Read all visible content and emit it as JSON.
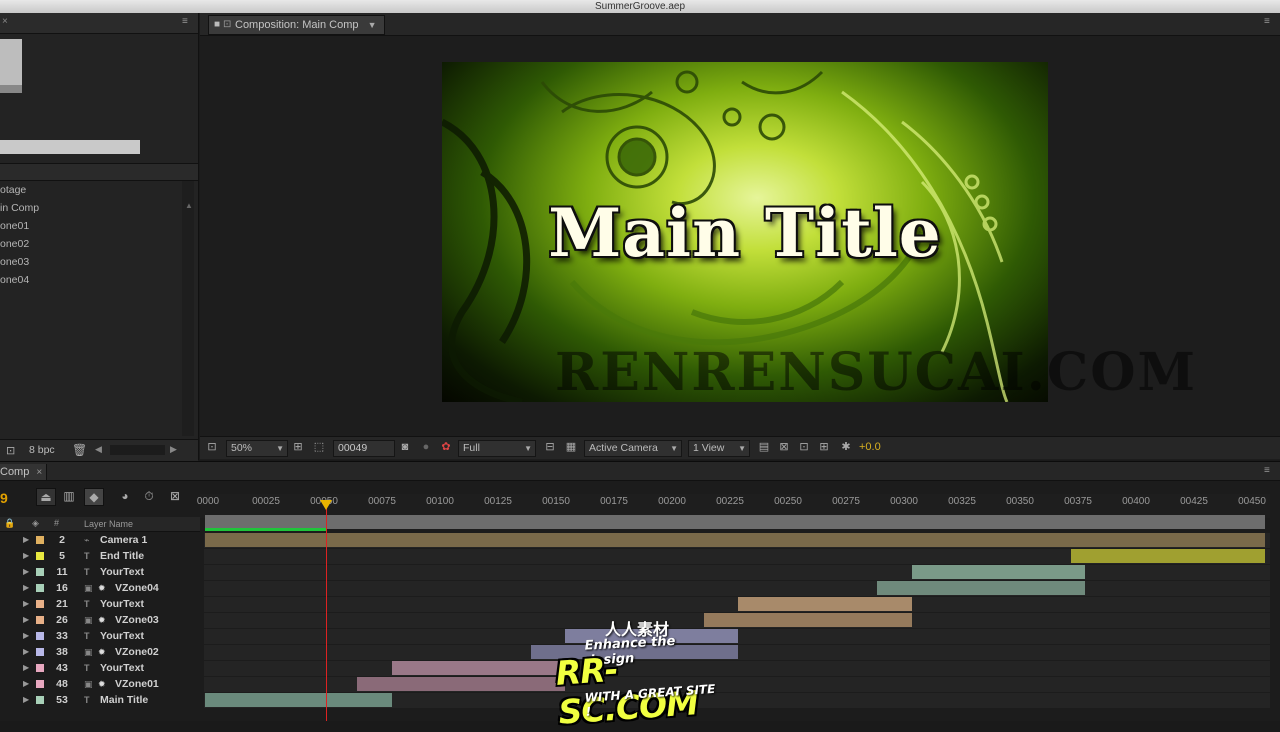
{
  "window": {
    "title": "SummerGroove.aep"
  },
  "project": {
    "items": [
      "otage",
      "in Comp",
      "one01",
      "one02",
      "one03",
      "one04"
    ],
    "footer": {
      "bpc": "8 bpc"
    }
  },
  "composition": {
    "tab_label": "Composition: Main Comp",
    "viewer_title": "Main Title",
    "watermark": "RENRENSUCAI.COM",
    "toolbar": {
      "zoom": "50%",
      "timecode": "00049",
      "resolution": "Full",
      "camera": "Active Camera",
      "views": "1 View",
      "exposure": "+0.0"
    }
  },
  "timeline": {
    "tab_label": "Comp",
    "timecode": "9",
    "column_header": "Layer Name",
    "ruler_ticks": [
      "0000",
      "00025",
      "00050",
      "00075",
      "00100",
      "00125",
      "00150",
      "00175",
      "00200",
      "00225",
      "00250",
      "00275",
      "00300",
      "00325",
      "00350",
      "00375",
      "00400",
      "00425",
      "00450"
    ],
    "layers": [
      {
        "num": "2",
        "name": "Camera 1",
        "type": "camera",
        "color": "#e0b060",
        "bar_start": 0,
        "bar_end": 459,
        "bar_color": "#7a6a4a"
      },
      {
        "num": "5",
        "name": "End Title",
        "type": "text",
        "color": "#e8e840",
        "bar_start": 375,
        "bar_end": 459,
        "bar_color": "#a0a030"
      },
      {
        "num": "11",
        "name": "YourText",
        "type": "text",
        "color": "#a8d0b8",
        "bar_start": 306,
        "bar_end": 381,
        "bar_color": "#7a9a88"
      },
      {
        "num": "16",
        "name": "VZone04",
        "type": "comp",
        "color": "#a8d0b8",
        "bar_start": 291,
        "bar_end": 381,
        "bar_color": "#6f8a7c"
      },
      {
        "num": "21",
        "name": "YourText",
        "type": "text",
        "color": "#e8b088",
        "bar_start": 231,
        "bar_end": 306,
        "bar_color": "#a88a6a"
      },
      {
        "num": "26",
        "name": "VZone03",
        "type": "comp",
        "color": "#e8b088",
        "bar_start": 216,
        "bar_end": 306,
        "bar_color": "#957a5c"
      },
      {
        "num": "33",
        "name": "YourText",
        "type": "text",
        "color": "#b8b8e8",
        "bar_start": 156,
        "bar_end": 231,
        "bar_color": "#7e7e9e"
      },
      {
        "num": "38",
        "name": "VZone02",
        "type": "comp",
        "color": "#b8b8e8",
        "bar_start": 141,
        "bar_end": 231,
        "bar_color": "#6f6f8c"
      },
      {
        "num": "43",
        "name": "YourText",
        "type": "text",
        "color": "#e8a8c0",
        "bar_start": 81,
        "bar_end": 156,
        "bar_color": "#9a7888"
      },
      {
        "num": "48",
        "name": "VZone01",
        "type": "comp",
        "color": "#e8a8c0",
        "bar_start": 66,
        "bar_end": 156,
        "bar_color": "#8a6a78"
      },
      {
        "num": "53",
        "name": "Main Title",
        "type": "text",
        "color": "#a8d0b8",
        "bar_start": 0,
        "bar_end": 81,
        "bar_color": "#6a8a7c"
      }
    ]
  },
  "logo": {
    "line1": "人人素材",
    "line2": "Enhance the design",
    "line3": "RR-SC.COM",
    "line4": "WITH A GREAT SITE !"
  },
  "colors": {
    "accent_timecode": "#e0a000",
    "playhead": "#dd2222",
    "cache": "#1fc43a"
  }
}
